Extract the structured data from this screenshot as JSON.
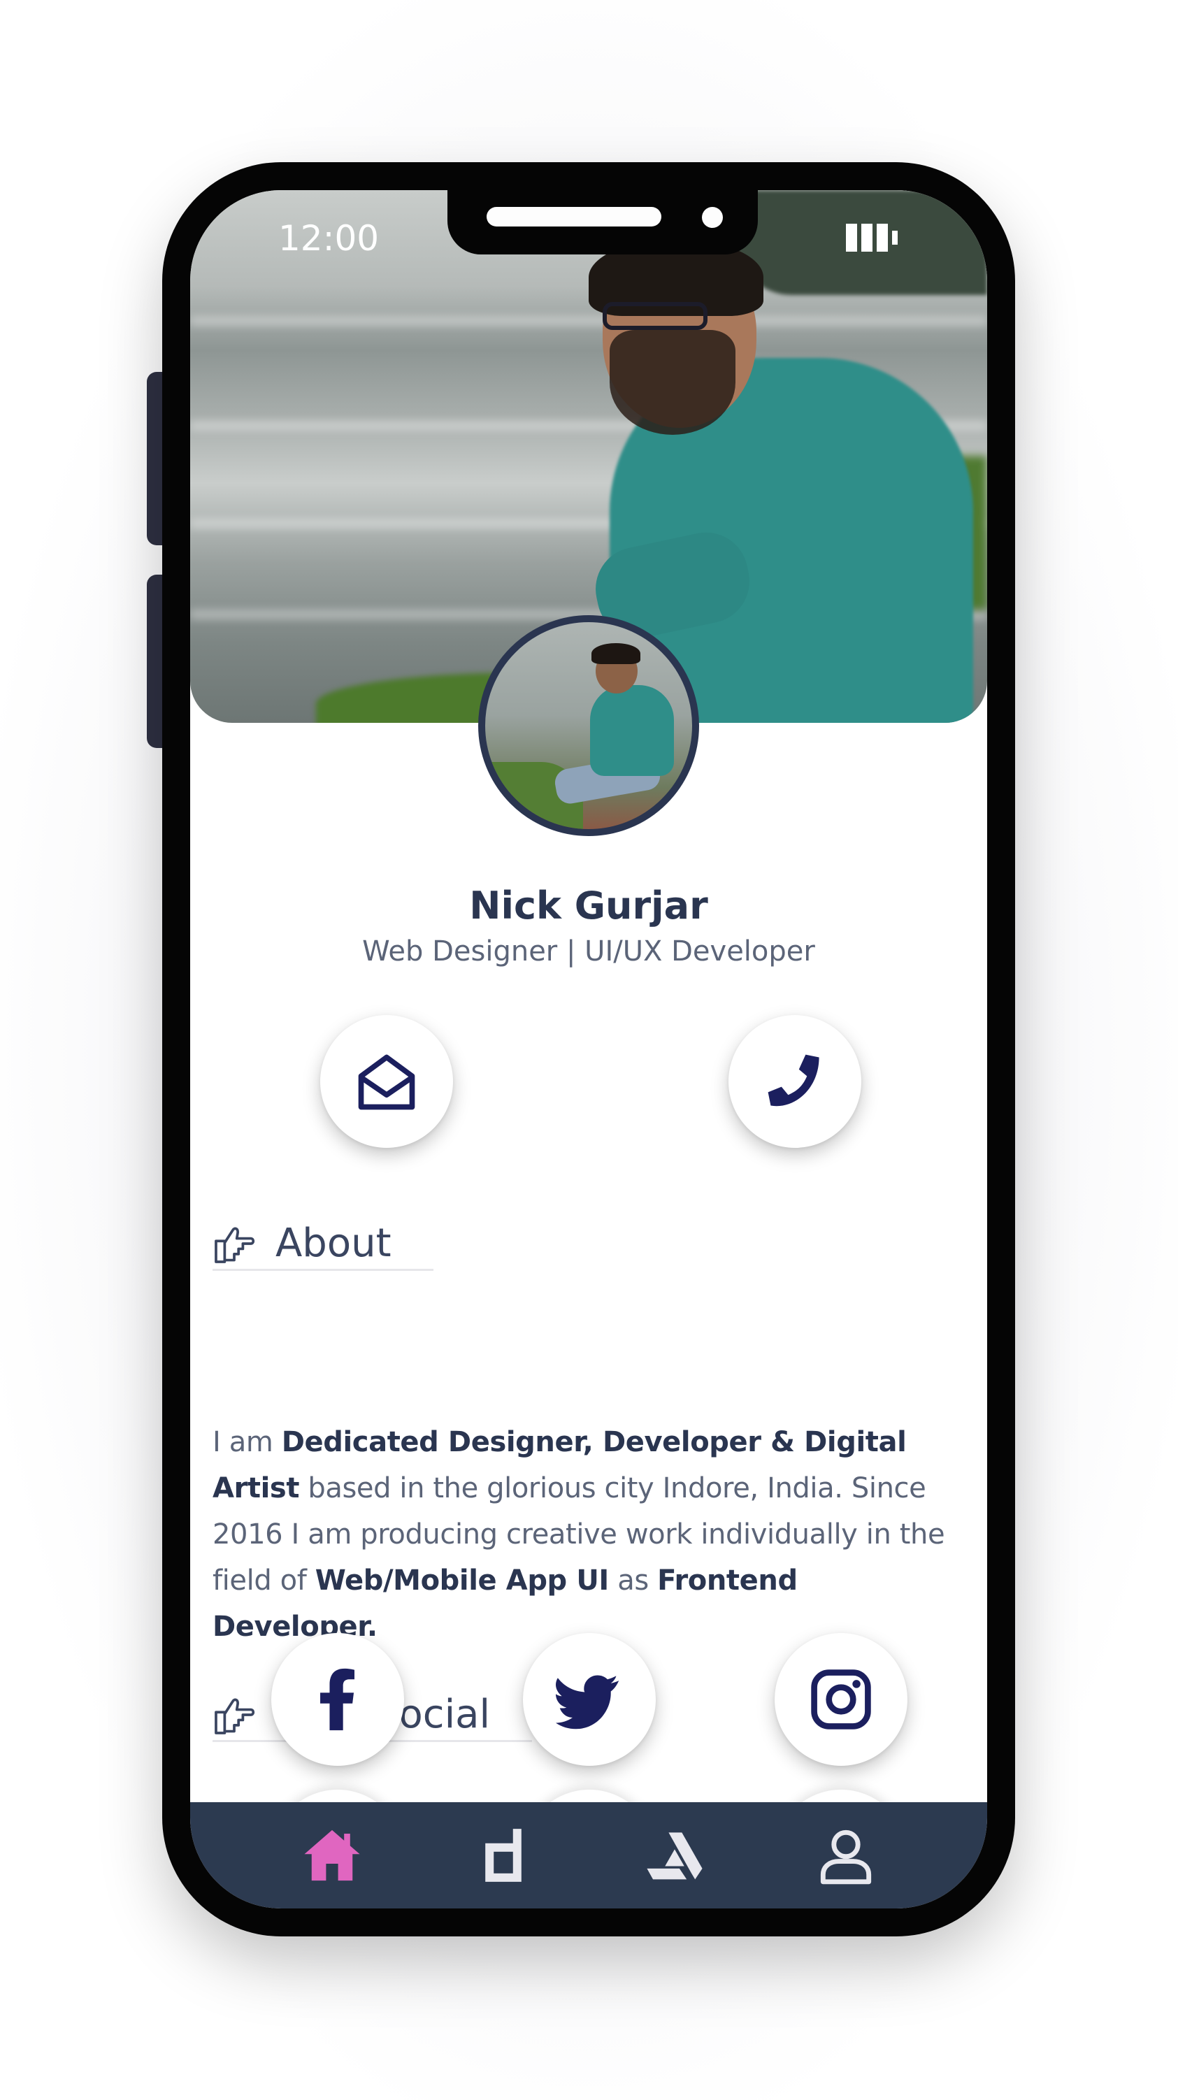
{
  "status_bar": {
    "time": "12:00",
    "battery_icon": "battery-icon"
  },
  "profile": {
    "name": "Nick Gurjar",
    "role": "Web Designer | UI/UX Developer",
    "cover_icon": "cover-photo",
    "avatar_icon": "profile-photo"
  },
  "contact": {
    "email_icon": "envelope-open-icon",
    "phone_icon": "phone-icon"
  },
  "about": {
    "title": "About",
    "icon": "thumbs-up-pointing-icon",
    "text_parts": [
      "I am ",
      "Dedicated Designer, Developer & Digital Artist",
      " based in the glorious city Indore, India. Since 2016 I am producing creative work individually in the field of ",
      "Web/Mobile App UI",
      " as ",
      "Frontend Developer."
    ]
  },
  "social": {
    "title": "I am Social",
    "icon": "thumbs-up-pointing-icon",
    "items": [
      "facebook-icon",
      "twitter-icon",
      "instagram-icon"
    ]
  },
  "bottom_nav": {
    "items": [
      "home-icon",
      "document-icon",
      "artstation-icon",
      "user-icon"
    ],
    "active_color": "#e066c0",
    "inactive_color": "#e8e8ee",
    "background": "#2c3a50"
  },
  "colors": {
    "accent": "#1b1f5e",
    "text": "#2a3550"
  }
}
